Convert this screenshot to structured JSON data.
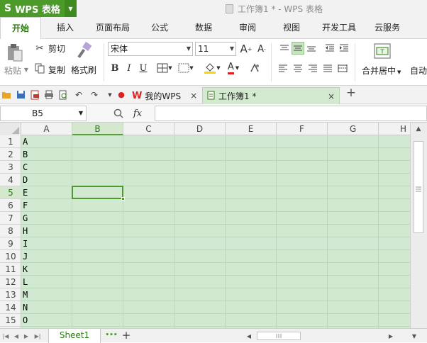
{
  "app": {
    "menu_label": "WPS 表格",
    "logo": "S",
    "window_title": "工作簿1 * - WPS 表格"
  },
  "ribbon_tabs": [
    "开始",
    "插入",
    "页面布局",
    "公式",
    "数据",
    "审阅",
    "视图",
    "开发工具",
    "云服务"
  ],
  "ribbon": {
    "paste": "粘贴",
    "cut": "剪切",
    "copy": "复制",
    "format_painter": "格式刷",
    "font_name": "宋体",
    "font_size": "11",
    "merge_center": "合并居中",
    "auto_wrap": "自动",
    "bold": "B",
    "italic": "I",
    "underline": "U",
    "grow_font": "A",
    "shrink_font": "A",
    "font_color": "A"
  },
  "doc_tabs": [
    {
      "label": "我的WPS",
      "close": "×"
    },
    {
      "label": "工作簿1 *",
      "close": "×"
    }
  ],
  "add_tab": "+",
  "formula_bar": {
    "cell_ref": "B5",
    "fx": "fx"
  },
  "grid": {
    "columns": [
      "A",
      "B",
      "C",
      "D",
      "E",
      "F",
      "G",
      "H"
    ],
    "rows": [
      "1",
      "2",
      "3",
      "4",
      "5",
      "6",
      "7",
      "8",
      "9",
      "10",
      "11",
      "12",
      "13",
      "14",
      "15"
    ],
    "active_col": "B",
    "active_row": "5",
    "column_a_values": [
      "A",
      "B",
      "C",
      "D",
      "E",
      "F",
      "G",
      "H",
      "I",
      "J",
      "K",
      "L",
      "M",
      "N",
      "O"
    ]
  },
  "sheets": {
    "active": "Sheet1",
    "more": "•••",
    "add": "+"
  },
  "colors": {
    "brand": "#4c9a2a",
    "sheet_bg": "#d1e9d1",
    "selection": "#4d9a2e"
  }
}
